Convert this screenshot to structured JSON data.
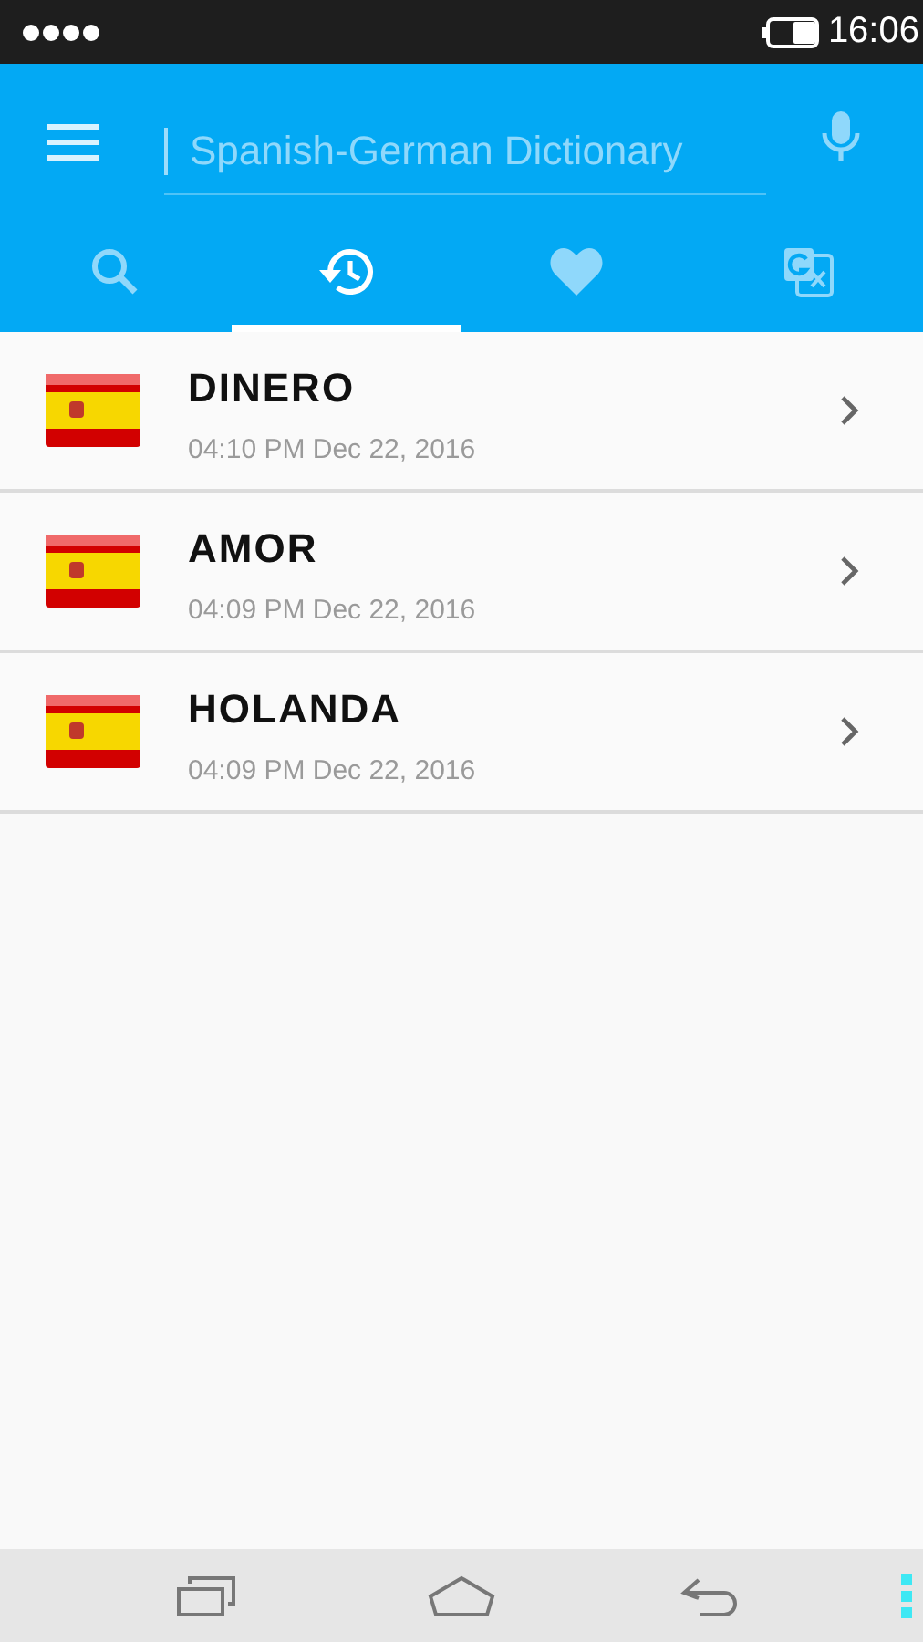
{
  "status_bar": {
    "time": "16:06"
  },
  "search": {
    "placeholder": "Spanish-German Dictionary"
  },
  "tabs": [
    {
      "kind": "search",
      "selected": false
    },
    {
      "kind": "history",
      "selected": true
    },
    {
      "kind": "favorites",
      "selected": false
    },
    {
      "kind": "translate",
      "selected": false
    }
  ],
  "history": [
    {
      "word": "DINERO",
      "time": "04:10 PM Dec 22, 2016"
    },
    {
      "word": "AMOR",
      "time": "04:09 PM Dec 22, 2016"
    },
    {
      "word": "HOLANDA",
      "time": "04:09 PM Dec 22, 2016"
    }
  ]
}
